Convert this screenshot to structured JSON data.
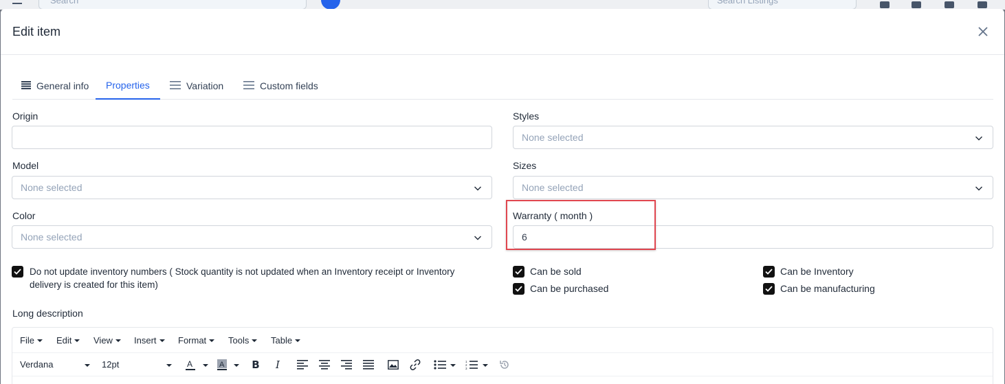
{
  "background": {
    "search_placeholder": "Search",
    "search_listings_placeholder": "Search Listings"
  },
  "modal": {
    "title": "Edit item",
    "close_icon": "close-icon"
  },
  "tabs": [
    {
      "label": "General info",
      "icon": "list-icon",
      "active": false
    },
    {
      "label": "Properties",
      "icon": "",
      "active": true
    },
    {
      "label": "Variation",
      "icon": "menu-icon",
      "active": false
    },
    {
      "label": "Custom fields",
      "icon": "menu-icon",
      "active": false
    }
  ],
  "fields": {
    "origin": {
      "label": "Origin",
      "value": ""
    },
    "styles": {
      "label": "Styles",
      "placeholder": "None selected"
    },
    "model": {
      "label": "Model",
      "placeholder": "None selected"
    },
    "sizes": {
      "label": "Sizes",
      "placeholder": "None selected"
    },
    "color": {
      "label": "Color",
      "placeholder": "None selected"
    },
    "warranty": {
      "label": "Warranty ( month )",
      "value": "6"
    }
  },
  "checkboxes": {
    "no_update_inventory": {
      "label_line1": "Do not update inventory numbers ( Stock quantity is not updated when an Inventory receipt or Inventory",
      "label_line2": "delivery is created for this item)",
      "checked": true
    },
    "can_be_sold": {
      "label": "Can be sold",
      "checked": true
    },
    "can_be_purchased": {
      "label": "Can be purchased",
      "checked": true
    },
    "can_be_inventory": {
      "label": "Can be Inventory",
      "checked": true
    },
    "can_be_manufacturing": {
      "label": "Can be manufacturing",
      "checked": true
    }
  },
  "long_description": {
    "label": "Long description",
    "menus": [
      "File",
      "Edit",
      "View",
      "Insert",
      "Format",
      "Tools",
      "Table"
    ],
    "font_family": "Verdana",
    "font_size": "12pt"
  },
  "colors": {
    "accent": "#2563eb",
    "highlight": "#e0464f"
  }
}
